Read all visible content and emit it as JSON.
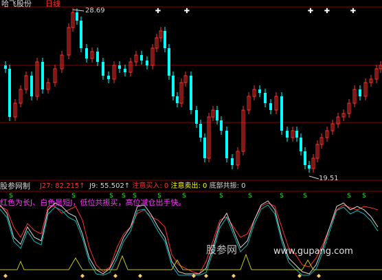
{
  "header": {
    "stock_name": "哈飞股份",
    "period": "日线",
    "price_high_label": "28.69",
    "price_low_label": "19.51"
  },
  "indicator": {
    "name": "股参网制",
    "values": [
      {
        "text": "J27: 82.215↑",
        "color": "#ff3030"
      },
      {
        "text": "J9: 55.502↑",
        "color": "#d8d8d8"
      },
      {
        "text": "注意买入: 0",
        "color": "#ff3030"
      },
      {
        "text": "注意卖出: 0",
        "color": "#ffff00"
      },
      {
        "text": "底部共振: 0",
        "color": "#d8d8d8"
      }
    ],
    "note": "红色为长J、白色是短J，低位共振买，高位减仓出手快。"
  },
  "watermark": {
    "text": "股参网",
    "url": "www.gupang.com"
  },
  "markers": {
    "sell_symbol": "S",
    "top_symbol": "✚"
  },
  "colors": {
    "background": "#000000",
    "up_candle": "#ff3030",
    "down_candle": "#00ffff",
    "grid": "#8b0000",
    "long_j": "#ff3030",
    "short_j": "#d8d8d8",
    "cyan_line": "#00c0c0",
    "signal_line": "#c8c800",
    "sell_marker": "#00ff00",
    "bottom_marker": "#ffcc66"
  }
}
